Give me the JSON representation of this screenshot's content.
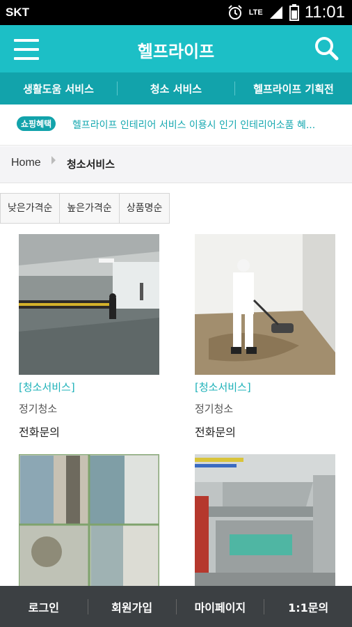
{
  "status_bar": {
    "carrier": "SKT",
    "network": "LTE",
    "time": "11:01"
  },
  "app_bar": {
    "title": "헬프라이프",
    "menu_icon": "hamburger-menu-icon",
    "search_icon": "search-icon"
  },
  "category_tabs": [
    {
      "label": "생활도움 서비스"
    },
    {
      "label": "청소 서비스"
    },
    {
      "label": "헬프라이프 기획전"
    }
  ],
  "promo": {
    "badge": "쇼핑혜택",
    "text": "헬프라이프 인테리어 서비스 이용시 인기 인테리어소품 혜..."
  },
  "breadcrumb": {
    "home": "Home",
    "current": "청소서비스"
  },
  "sort_options": [
    {
      "label": "낮은가격순"
    },
    {
      "label": "높은가격순"
    },
    {
      "label": "상품명순"
    }
  ],
  "products": [
    {
      "category": "[청소서비스]",
      "name": "정기청소",
      "price": "전화문의",
      "image": "parking-garage-cleaning-photo"
    },
    {
      "category": "[청소서비스]",
      "name": "정기청소",
      "price": "전화문의",
      "image": "floor-scrubbing-photo"
    },
    {
      "category": "",
      "name": "",
      "price": "",
      "image": "mold-window-cleaning-photo"
    },
    {
      "category": "",
      "name": "",
      "price": "",
      "image": "kitchen-hood-cleaning-photo"
    }
  ],
  "bottom_nav": [
    {
      "label": "로그인"
    },
    {
      "label": "회원가입"
    },
    {
      "label": "마이페이지"
    },
    {
      "label": "1:1문의"
    }
  ],
  "colors": {
    "primary": "#1cbfc6",
    "primary_dark": "#12a3ab",
    "bottom_nav": "#3c4043"
  }
}
